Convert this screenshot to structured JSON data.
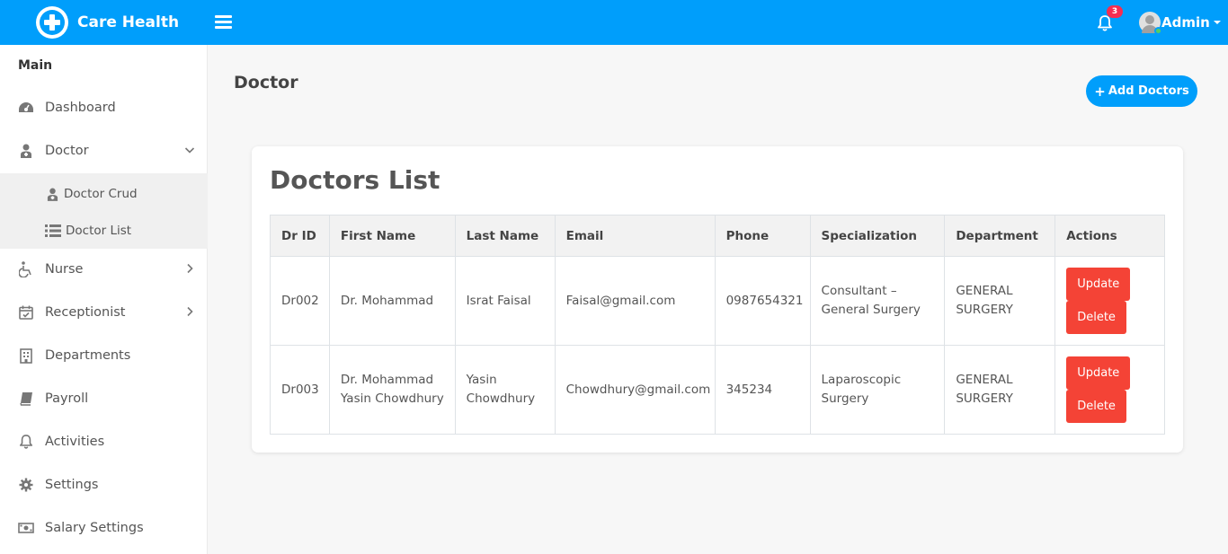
{
  "header": {
    "brand": "Care Health",
    "notification_count": "3",
    "user_name": "Admin"
  },
  "sidebar": {
    "section_title": "Main",
    "items": [
      {
        "label": "Dashboard",
        "icon": "dashboard-icon"
      },
      {
        "label": "Doctor",
        "icon": "user-md-icon"
      },
      {
        "label": "Nurse",
        "icon": "wheelchair-icon"
      },
      {
        "label": "Receptionist",
        "icon": "calendar-check-icon"
      },
      {
        "label": "Departments",
        "icon": "building-icon"
      },
      {
        "label": "Payroll",
        "icon": "book-icon"
      },
      {
        "label": "Activities",
        "icon": "bell-icon"
      },
      {
        "label": "Settings",
        "icon": "gear-icon"
      },
      {
        "label": "Salary Settings",
        "icon": "money-bill-icon"
      }
    ],
    "doctor_submenu": [
      {
        "label": "Doctor Crud",
        "icon": "user-md-icon"
      },
      {
        "label": "Doctor List",
        "icon": "list-icon"
      }
    ]
  },
  "main": {
    "page_title": "Doctor",
    "add_button": "Add Doctors",
    "card_title": "Doctors List",
    "table": {
      "headers": [
        "Dr ID",
        "First Name",
        "Last Name",
        "Email",
        "Phone",
        "Specialization",
        "Department",
        "Actions"
      ],
      "rows": [
        {
          "id": "Dr002",
          "first": "Dr. Mohammad",
          "last": "Israt Faisal",
          "email": "Faisal@gmail.com",
          "phone": "0987654321",
          "spec": "Consultant – General Surgery",
          "dept": "GENERAL SURGERY",
          "update": "Update",
          "delete": "Delete"
        },
        {
          "id": "Dr003",
          "first": "Dr. Mohammad Yasin Chowdhury",
          "last": "Yasin Chowdhury",
          "email": "Chowdhury@gmail.com",
          "phone": "345234",
          "spec": "Laparoscopic Surgery",
          "dept": "GENERAL SURGERY",
          "update": "Update",
          "delete": "Delete"
        }
      ]
    }
  },
  "colors": {
    "primary": "#009efb",
    "danger": "#f44336",
    "badge": "#f62d51"
  }
}
